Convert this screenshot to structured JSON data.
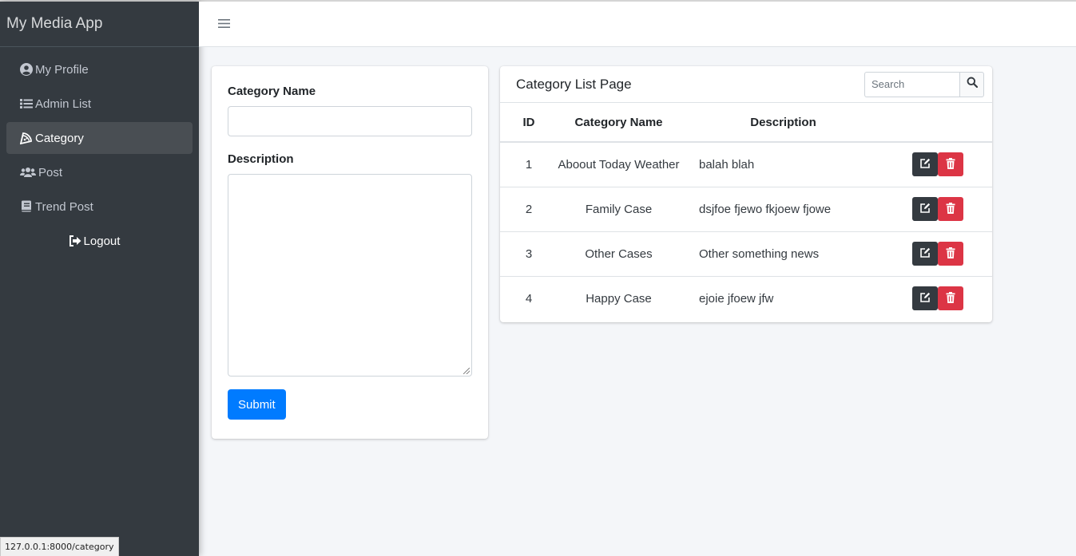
{
  "app": {
    "title": "My Media App"
  },
  "sidebar": {
    "items": [
      {
        "label": "My Profile",
        "icon": "user-circle-icon"
      },
      {
        "label": "Admin List",
        "icon": "list-icon"
      },
      {
        "label": "Category",
        "icon": "pizza-icon",
        "active": true
      },
      {
        "label": "Post",
        "icon": "users-icon"
      },
      {
        "label": "Trend Post",
        "icon": "book-icon"
      }
    ],
    "logout": {
      "label": "Logout",
      "icon": "sign-out-icon"
    }
  },
  "form": {
    "name_label": "Category Name",
    "name_value": "",
    "description_label": "Description",
    "description_value": "",
    "submit_label": "Submit"
  },
  "list": {
    "title": "Category List Page",
    "search_placeholder": "Search",
    "columns": [
      "ID",
      "Category Name",
      "Description"
    ],
    "rows": [
      {
        "id": "1",
        "name": "Aboout Today Weather",
        "description": "balah blah"
      },
      {
        "id": "2",
        "name": "Family Case",
        "description": "dsjfoe fjewo fkjoew fjowe"
      },
      {
        "id": "3",
        "name": "Other Cases",
        "description": "Other something news"
      },
      {
        "id": "4",
        "name": "Happy Case",
        "description": "ejoie jfoew jfw"
      }
    ]
  },
  "status_url": "127.0.0.1:8000/category",
  "colors": {
    "sidebar": "#343a40",
    "primary": "#007bff",
    "danger": "#dc3545",
    "dark": "#343a40"
  }
}
